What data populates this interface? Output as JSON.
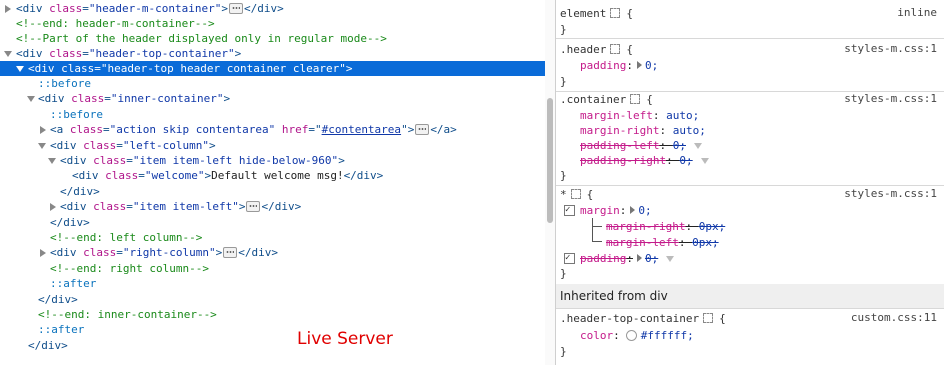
{
  "markup": {
    "l1": {
      "tag_open": "<div ",
      "attr": "class",
      "eq": "=",
      "val": "\"header-m-container\"",
      "tag_close": ">",
      "end": "</div>"
    },
    "l2": {
      "comment": "<!--end: header-m-container-->"
    },
    "l3": {
      "comment": "<!--Part of the header displayed only in regular mode-->"
    },
    "l4": {
      "tag_open": "<div ",
      "attr": "class",
      "eq": "=",
      "val": "\"header-top-container\"",
      "tag_close": ">"
    },
    "l5": {
      "tag_open": "<div ",
      "attr": "class",
      "eq": "=",
      "val": "\"header-top header container clearer\"",
      "tag_close": ">"
    },
    "l6": {
      "pseudo": "::before"
    },
    "l7": {
      "tag_open": "<div ",
      "attr": "class",
      "eq": "=",
      "val": "\"inner-container\"",
      "tag_close": ">"
    },
    "l8": {
      "pseudo": "::before"
    },
    "l9": {
      "tag_open": "<a ",
      "attr": "class",
      "eq": "=",
      "val": "\"action skip contentarea\"",
      "attr2": " href",
      "eq2": "=\"",
      "link": "#contentarea",
      "q": "\"",
      "tag_close": ">",
      "end": "</a>"
    },
    "l10": {
      "tag_open": "<div ",
      "attr": "class",
      "eq": "=",
      "val": "\"left-column\"",
      "tag_close": ">"
    },
    "l11": {
      "tag_open": "<div ",
      "attr": "class",
      "eq": "=",
      "val": "\"item item-left hide-below-960\"",
      "tag_close": ">"
    },
    "l12": {
      "tag_open": "<div ",
      "attr": "class",
      "eq": "=",
      "val": "\"welcome\"",
      "tag_close": ">",
      "text": "Default welcome msg!",
      "end": "</div>"
    },
    "l13": {
      "end": "</div>"
    },
    "l14": {
      "tag_open": "<div ",
      "attr": "class",
      "eq": "=",
      "val": "\"item item-left\"",
      "tag_close": ">",
      "end": "</div>"
    },
    "l15": {
      "end": "</div>"
    },
    "l16": {
      "comment": "<!--end: left column-->"
    },
    "l17": {
      "tag_open": "<div ",
      "attr": "class",
      "eq": "=",
      "val": "\"right-column\"",
      "tag_close": ">",
      "end": "</div>"
    },
    "l18": {
      "comment": "<!--end: right column-->"
    },
    "l19": {
      "pseudo": "::after"
    },
    "l20": {
      "end": "</div>"
    },
    "l21": {
      "comment": "<!--end: inner-container-->"
    },
    "l22": {
      "pseudo": "::after"
    },
    "l23": {
      "end": "</div>"
    }
  },
  "overlay_label": "Live Server",
  "rules": {
    "element": {
      "selector": "element",
      "open": "{",
      "source": "inline",
      "close": "}"
    },
    "header": {
      "selector": ".header",
      "open": "{",
      "source": "styles-m.css:1",
      "p1_name": "padding",
      "p1_val": "0;",
      "close": "}"
    },
    "container": {
      "selector": ".container",
      "open": "{",
      "source": "styles-m.css:1",
      "p1_name": "margin-left",
      "p1_val": "auto;",
      "p2_name": "margin-right",
      "p2_val": "auto;",
      "p3_name": "padding-left",
      "p3_val": "0;",
      "p4_name": "padding-right",
      "p4_val": "0;",
      "close": "}"
    },
    "universal": {
      "selector": "*",
      "open": "{",
      "source": "styles-m.css:1",
      "p1_name": "margin",
      "p1_val": "0;",
      "s1_name": "margin-right",
      "s1_val": "0px;",
      "s2_name": "margin-left",
      "s2_val": "0px;",
      "p2_name": "padding",
      "p2_val": "0;",
      "close": "}"
    },
    "inherited_label": "Inherited from div",
    "htc": {
      "selector": ".header-top-container",
      "open": "{",
      "source": "custom.css:11",
      "p1_name": "color",
      "p1_val": "#ffffff;",
      "close": "}"
    }
  },
  "colors": {
    "selected_row": "#0a6bd8",
    "live_server": "#e00000",
    "swatch": "#ffffff"
  }
}
